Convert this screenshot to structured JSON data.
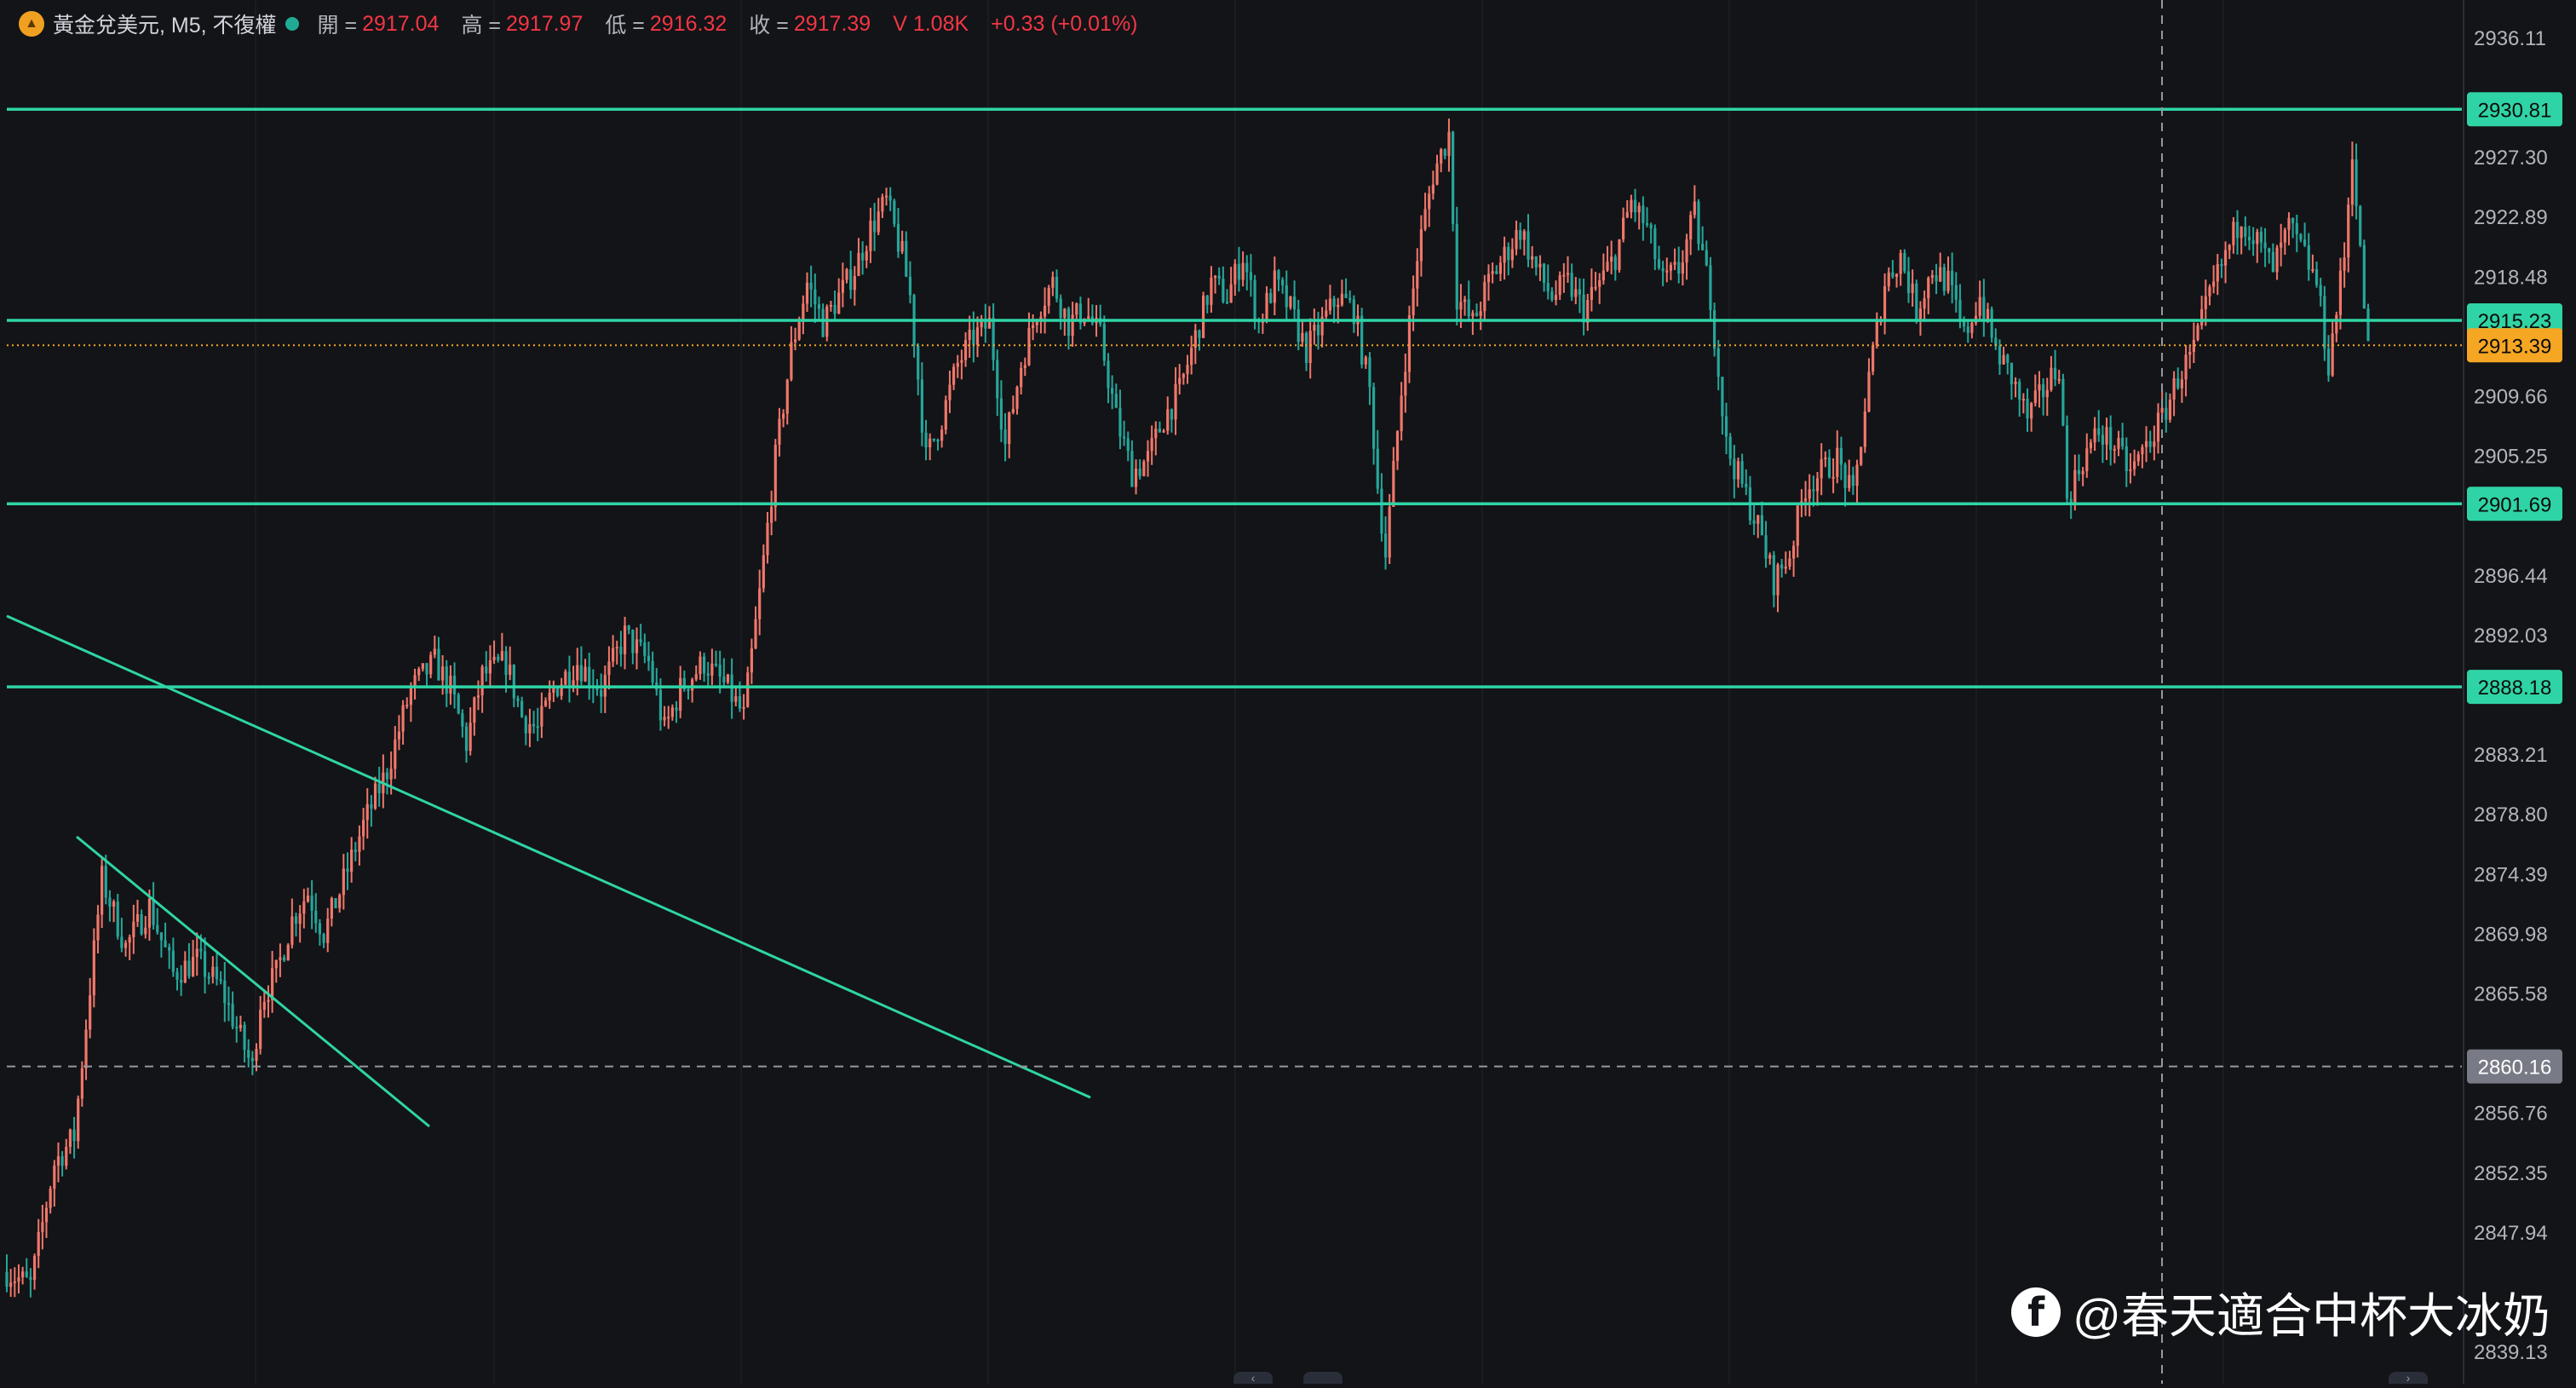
{
  "legend": {
    "symbol": "黃金兌美元, M5, 不復權",
    "open_label": "開 =",
    "open_value": "2917.04",
    "high_label": "高 =",
    "high_value": "2917.97",
    "low_label": "低 =",
    "low_value": "2916.32",
    "close_label": "收 =",
    "close_value": "2917.39",
    "volume": "V 1.08K",
    "change": "+0.33 (+0.01%)"
  },
  "watermark": {
    "icon": "facebook-icon",
    "text": "@春天適合中杯大冰奶"
  },
  "colors": {
    "background": "#131417",
    "up": "#f0776b",
    "down": "#26a69a",
    "drawing": "#2fd4a6",
    "current_price": "#f5a623",
    "legend_value": "#f23645"
  },
  "chart_data": {
    "type": "candlestick",
    "y_range": [
      2838,
      2938
    ],
    "y_ticks": [
      "2936.11",
      "2927.30",
      "2922.89",
      "2918.48",
      "2909.66",
      "2905.25",
      "2896.44",
      "2892.03",
      "2883.21",
      "2878.80",
      "2874.39",
      "2869.98",
      "2865.58",
      "2856.76",
      "2852.35",
      "2847.94",
      "2839.13"
    ],
    "horizontal_levels": [
      {
        "price": 2930.81,
        "label": "2930.81"
      },
      {
        "price": 2915.23,
        "label": "2915.23"
      },
      {
        "price": 2901.69,
        "label": "2901.69"
      },
      {
        "price": 2888.18,
        "label": "2888.18"
      }
    ],
    "current_price": {
      "price": 2913.39,
      "label": "2913.39"
    },
    "crosshair_price": {
      "price": 2860.16,
      "label": "2860.16"
    },
    "path_anchors": [
      [
        0,
        2845
      ],
      [
        6,
        2844
      ],
      [
        12,
        2853
      ],
      [
        17,
        2855
      ],
      [
        21,
        2866
      ],
      [
        24,
        2874
      ],
      [
        30,
        2869
      ],
      [
        36,
        2872
      ],
      [
        42,
        2867
      ],
      [
        48,
        2868
      ],
      [
        54,
        2866
      ],
      [
        58,
        2863
      ],
      [
        62,
        2860
      ],
      [
        64,
        2865
      ],
      [
        68,
        2867
      ],
      [
        72,
        2871
      ],
      [
        76,
        2873
      ],
      [
        80,
        2870
      ],
      [
        84,
        2873
      ],
      [
        90,
        2878
      ],
      [
        96,
        2882
      ],
      [
        102,
        2888
      ],
      [
        108,
        2890
      ],
      [
        112,
        2888
      ],
      [
        116,
        2884
      ],
      [
        120,
        2889
      ],
      [
        126,
        2890
      ],
      [
        130,
        2886
      ],
      [
        134,
        2885
      ],
      [
        138,
        2888
      ],
      [
        144,
        2890
      ],
      [
        150,
        2888
      ],
      [
        156,
        2892
      ],
      [
        162,
        2890
      ],
      [
        166,
        2885
      ],
      [
        170,
        2888
      ],
      [
        176,
        2890
      ],
      [
        182,
        2888
      ],
      [
        186,
        2886
      ],
      [
        190,
        2895
      ],
      [
        194,
        2905
      ],
      [
        198,
        2913
      ],
      [
        202,
        2918
      ],
      [
        206,
        2915
      ],
      [
        210,
        2917
      ],
      [
        214,
        2919
      ],
      [
        218,
        2922
      ],
      [
        222,
        2924
      ],
      [
        226,
        2920
      ],
      [
        228,
        2917
      ],
      [
        232,
        2905
      ],
      [
        236,
        2908
      ],
      [
        240,
        2912
      ],
      [
        244,
        2914
      ],
      [
        248,
        2915
      ],
      [
        252,
        2906
      ],
      [
        256,
        2912
      ],
      [
        260,
        2916
      ],
      [
        264,
        2918
      ],
      [
        268,
        2915
      ],
      [
        272,
        2916
      ],
      [
        276,
        2914
      ],
      [
        280,
        2908
      ],
      [
        284,
        2904
      ],
      [
        288,
        2905
      ],
      [
        292,
        2908
      ],
      [
        296,
        2910
      ],
      [
        300,
        2914
      ],
      [
        304,
        2918
      ],
      [
        308,
        2917
      ],
      [
        312,
        2920
      ],
      [
        316,
        2915
      ],
      [
        320,
        2918
      ],
      [
        324,
        2916
      ],
      [
        328,
        2913
      ],
      [
        332,
        2915
      ],
      [
        336,
        2917
      ],
      [
        340,
        2916
      ],
      [
        344,
        2910
      ],
      [
        346,
        2903
      ],
      [
        348,
        2898
      ],
      [
        352,
        2910
      ],
      [
        356,
        2920
      ],
      [
        360,
        2926
      ],
      [
        364,
        2929
      ],
      [
        366,
        2917
      ],
      [
        370,
        2915
      ],
      [
        374,
        2918
      ],
      [
        378,
        2920
      ],
      [
        382,
        2922
      ],
      [
        386,
        2919
      ],
      [
        390,
        2917
      ],
      [
        394,
        2918
      ],
      [
        398,
        2916
      ],
      [
        402,
        2918
      ],
      [
        406,
        2920
      ],
      [
        410,
        2924
      ],
      [
        414,
        2922
      ],
      [
        418,
        2918
      ],
      [
        422,
        2919
      ],
      [
        426,
        2923
      ],
      [
        430,
        2917
      ],
      [
        434,
        2906
      ],
      [
        438,
        2903
      ],
      [
        442,
        2900
      ],
      [
        446,
        2896
      ],
      [
        450,
        2898
      ],
      [
        454,
        2903
      ],
      [
        458,
        2904
      ],
      [
        462,
        2905
      ],
      [
        466,
        2902
      ],
      [
        470,
        2911
      ],
      [
        474,
        2918
      ],
      [
        478,
        2920
      ],
      [
        482,
        2916
      ],
      [
        486,
        2919
      ],
      [
        490,
        2918
      ],
      [
        494,
        2914
      ],
      [
        498,
        2917
      ],
      [
        502,
        2913
      ],
      [
        506,
        2911
      ],
      [
        510,
        2908
      ],
      [
        514,
        2910
      ],
      [
        518,
        2912
      ],
      [
        520,
        2902
      ],
      [
        524,
        2905
      ],
      [
        528,
        2907
      ],
      [
        532,
        2906
      ],
      [
        536,
        2904
      ],
      [
        540,
        2906
      ],
      [
        544,
        2908
      ],
      [
        548,
        2911
      ],
      [
        552,
        2913
      ],
      [
        556,
        2917
      ],
      [
        560,
        2920
      ],
      [
        564,
        2923
      ],
      [
        568,
        2921
      ],
      [
        572,
        2919
      ],
      [
        576,
        2922
      ],
      [
        580,
        2920
      ],
      [
        583,
        2918
      ],
      [
        586,
        2912
      ],
      [
        590,
        2920
      ],
      [
        592,
        2928
      ],
      [
        594,
        2920
      ],
      [
        596,
        2913
      ]
    ]
  }
}
